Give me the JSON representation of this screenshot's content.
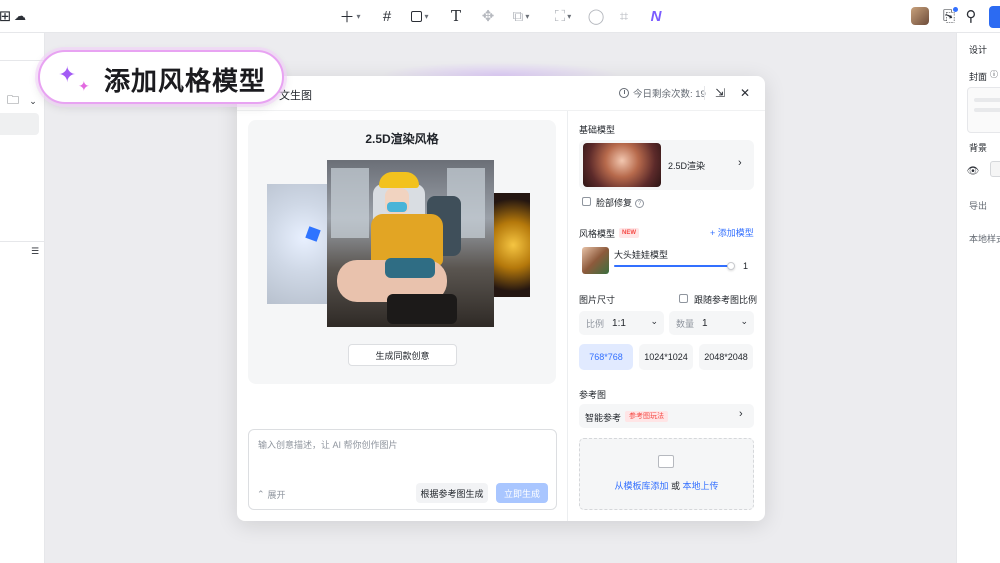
{
  "annotation": {
    "text": "添加风格模型"
  },
  "topbar": {
    "icons": [
      "add-icon",
      "frame-icon",
      "shape-icon",
      "text-icon",
      "component-icon",
      "group-icon",
      "mask-icon",
      "circle-icon",
      "crop-icon",
      "ai-icon"
    ]
  },
  "right_panel": {
    "design_label": "设计",
    "cover_label": "封面",
    "background_label": "背景",
    "export_label": "导出",
    "local_style_label": "本地样式"
  },
  "dialog": {
    "title": "文生图",
    "remaining_label": "今日剩余次数: 19",
    "preview": {
      "title": "2.5D渲染风格",
      "button": "生成同款创意"
    },
    "prompt": {
      "placeholder": "输入创意描述，让 AI 帮你创作图片",
      "expand_label": "展开",
      "ref_gen_button": "根据参考图生成",
      "generate_button": "立即生成"
    },
    "settings": {
      "base_model_label": "基础模型",
      "base_model_name": "2.5D渲染",
      "face_fix_label": "脸部修复",
      "style_model_label": "风格模型",
      "new_badge": "NEW",
      "add_model_label": "+ 添加模型",
      "style_model_name": "大头娃娃模型",
      "style_weight": "1",
      "style_weight_fraction": 0.97,
      "image_size_label": "图片尺寸",
      "follow_ref_label": "跟随参考图比例",
      "ratio_key": "比例",
      "ratio_value": "1:1",
      "count_key": "数量",
      "count_value": "1",
      "sizes": [
        "768*768",
        "1024*1024",
        "2048*2048"
      ],
      "reference_label": "参考图",
      "smart_ref_label": "智能参考",
      "ref_badge": "参考图玩法",
      "upload_from_template": "从模板库添加",
      "upload_or": "或",
      "upload_local": "本地上传"
    }
  },
  "colors": {
    "accent": "#3370ff",
    "pill_border": "#e8a3f2",
    "badge_red": "#f54a45"
  }
}
